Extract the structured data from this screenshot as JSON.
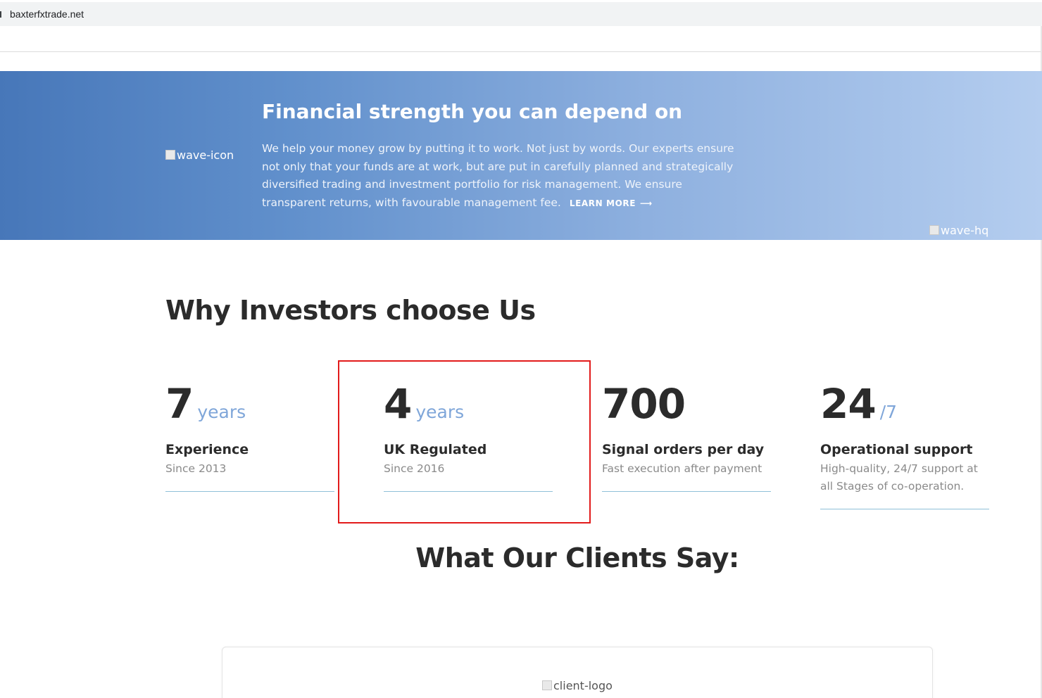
{
  "browser": {
    "url": "baxterfxtrade.net"
  },
  "hero": {
    "image_alt_left": "wave-icon",
    "image_alt_right": "wave-hq",
    "title": "Financial strength you can depend on",
    "text": "We help your money grow by putting it to work. Not just by words. Our experts ensure not only that your funds are at work, but are put in carefully planned and strategically diversified trading and investment portfolio for risk management. We ensure transparent returns, with favourable management fee.",
    "learn_more": "LEARN MORE",
    "learn_more_icon": "arrow-right-icon",
    "gradient": [
      "#4777b9",
      "#b4cdef"
    ]
  },
  "why": {
    "title": "Why Investors choose Us",
    "stats": [
      {
        "number": "7",
        "unit": "years",
        "label": "Experience",
        "desc": "Since 2013"
      },
      {
        "number": "4",
        "unit": "years",
        "label": "UK Regulated",
        "desc": "Since 2016"
      },
      {
        "number": "700",
        "unit": "",
        "label": "Signal orders per day",
        "desc": "Fast execution after payment"
      },
      {
        "number": "24",
        "unit": "/7",
        "label": "Operational support",
        "desc": "High-quality, 24/7 support at all Stages of co-operation."
      }
    ]
  },
  "clients": {
    "title": "What Our Clients Say:",
    "logo_alt": "client-logo"
  },
  "colors": {
    "accent": "#7fa6d9",
    "highlight_border": "#e21b1b",
    "rule": "#8fc0d8"
  }
}
